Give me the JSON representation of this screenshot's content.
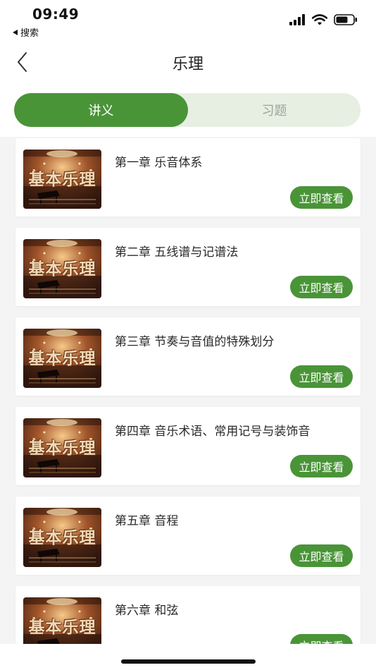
{
  "status_bar": {
    "time": "09:49",
    "back_app_label": "搜索",
    "icons": [
      "signal-icon",
      "wifi-icon",
      "battery-icon"
    ]
  },
  "header": {
    "title": "乐理",
    "back_icon": "chevron-left-icon"
  },
  "tabs": [
    {
      "label": "讲义",
      "active": true
    },
    {
      "label": "习题",
      "active": false
    }
  ],
  "thumbnail_text": "基本乐理",
  "view_button_label": "立即查看",
  "chapters": [
    {
      "title": "第一章 乐音体系"
    },
    {
      "title": "第二章 五线谱与记谱法"
    },
    {
      "title": "第三章 节奏与音值的特殊划分"
    },
    {
      "title": "第四章 音乐术语、常用记号与装饰音"
    },
    {
      "title": "第五章 音程"
    },
    {
      "title": "第六章 和弦"
    }
  ],
  "colors": {
    "accent": "#4a9438",
    "tab_bg": "#e7efe3",
    "page_bg": "#f4f4f4"
  }
}
